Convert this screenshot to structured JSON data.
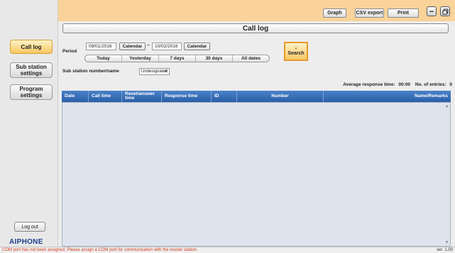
{
  "sidebar": {
    "call_log": "Call log",
    "sub_station_settings": "Sub station settings",
    "program_settings": "Program settings",
    "logout": "Log out",
    "logo": "AIPHONE"
  },
  "topbar": {
    "graph": "Graph",
    "csv_export": "CSV export",
    "print": "Print",
    "minimize_icon": "minimize-icon",
    "restore_icon": "restore-icon"
  },
  "main": {
    "title": "Call log",
    "period_label": "Period",
    "date_from": "09/01/2016",
    "date_to": "10/02/2016",
    "date_separator": "~",
    "calendar_label": "Calendar",
    "ranges": [
      "Today",
      "Yesterday",
      "7 days",
      "30 days",
      "All dates"
    ],
    "search": "Search",
    "sub_station_label": "Sub station number/name",
    "sub_station_value": "Undesignated",
    "avg_label": "Average response time:",
    "avg_value": "00:00",
    "entries_label": "No. of entries:",
    "entries_value": "0"
  },
  "table": {
    "columns": [
      "Date",
      "Call time",
      "Reset/answer time",
      "Response time",
      "ID",
      "Number",
      "Name/Remarks"
    ]
  },
  "status": {
    "message": "COM port has not been assigned. Please assign a COM port for communication with the master station.",
    "version": "ver. 1.00"
  },
  "colors": {
    "topbar": "#fad39a",
    "accent": "#f7c860",
    "table_header": "#2a5fa8",
    "error_text": "#d23a1a"
  }
}
